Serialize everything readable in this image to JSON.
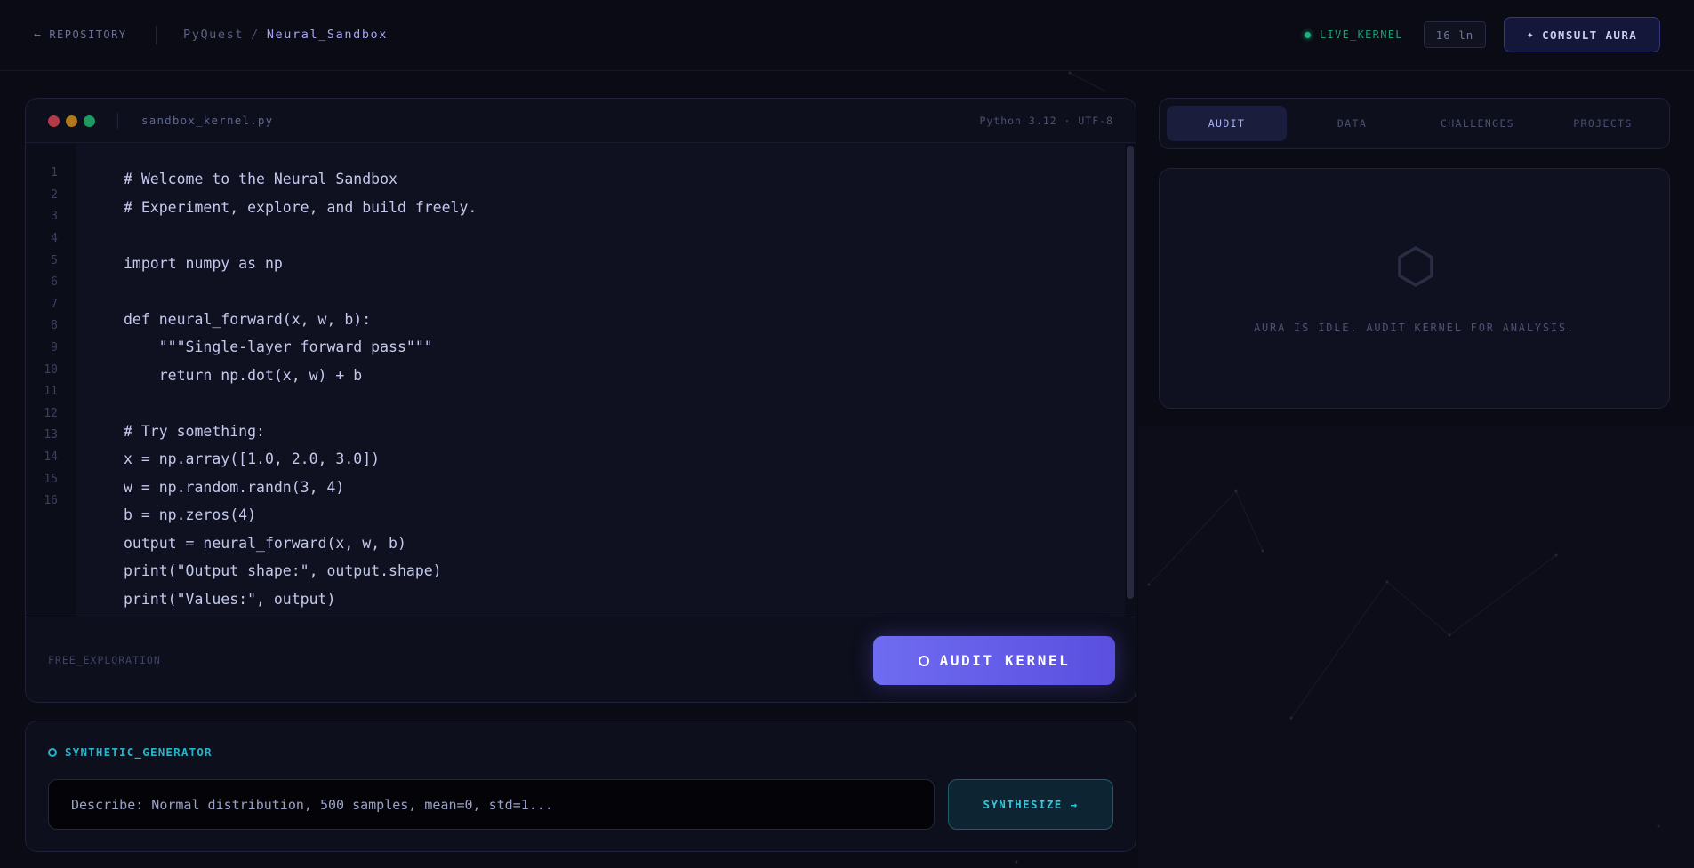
{
  "header": {
    "back_label": "REPOSITORY",
    "breadcrumb_root": "PyQuest",
    "breadcrumb_sep": "/",
    "breadcrumb_current": "Neural_Sandbox",
    "status_label": "LIVE_KERNEL",
    "status_color": "#1fb07e",
    "line_count": "16 ln",
    "consult_label": "CONSULT AURA"
  },
  "editor": {
    "filename": "sandbox_kernel.py",
    "runtime": "Python 3.12 · UTF-8",
    "line_numbers": [
      "1",
      "2",
      "3",
      "4",
      "5",
      "6",
      "7",
      "8",
      "9",
      "10",
      "11",
      "12",
      "13",
      "14",
      "15",
      "16"
    ],
    "code": [
      "# Welcome to the Neural Sandbox",
      "# Experiment, explore, and build freely.",
      "",
      "import numpy as np",
      "",
      "def neural_forward(x, w, b):",
      "    \"\"\"Single-layer forward pass\"\"\"",
      "    return np.dot(x, w) + b",
      "",
      "# Try something:",
      "x = np.array([1.0, 2.0, 3.0])",
      "w = np.random.randn(3, 4)",
      "b = np.zeros(4)",
      "output = neural_forward(x, w, b)",
      "print(\"Output shape:\", output.shape)",
      "print(\"Values:\", output)"
    ],
    "mode_label": "FREE_EXPLORATION",
    "audit_label": "AUDIT KERNEL",
    "accent_color": "#6f6cf0"
  },
  "synth": {
    "title": "SYNTHETIC_GENERATOR",
    "placeholder": "Describe: Normal distribution, 500 samples, mean=0, std=1...",
    "button_label": "SYNTHESIZE →",
    "accent_color": "#27b4c8"
  },
  "tabs": [
    {
      "label": "AUDIT",
      "active": true
    },
    {
      "label": "DATA",
      "active": false
    },
    {
      "label": "CHALLENGES",
      "active": false
    },
    {
      "label": "PROJECTS",
      "active": false
    }
  ],
  "aura": {
    "icon": "hexagon-icon",
    "message": "AURA IS IDLE. AUDIT KERNEL FOR ANALYSIS."
  }
}
